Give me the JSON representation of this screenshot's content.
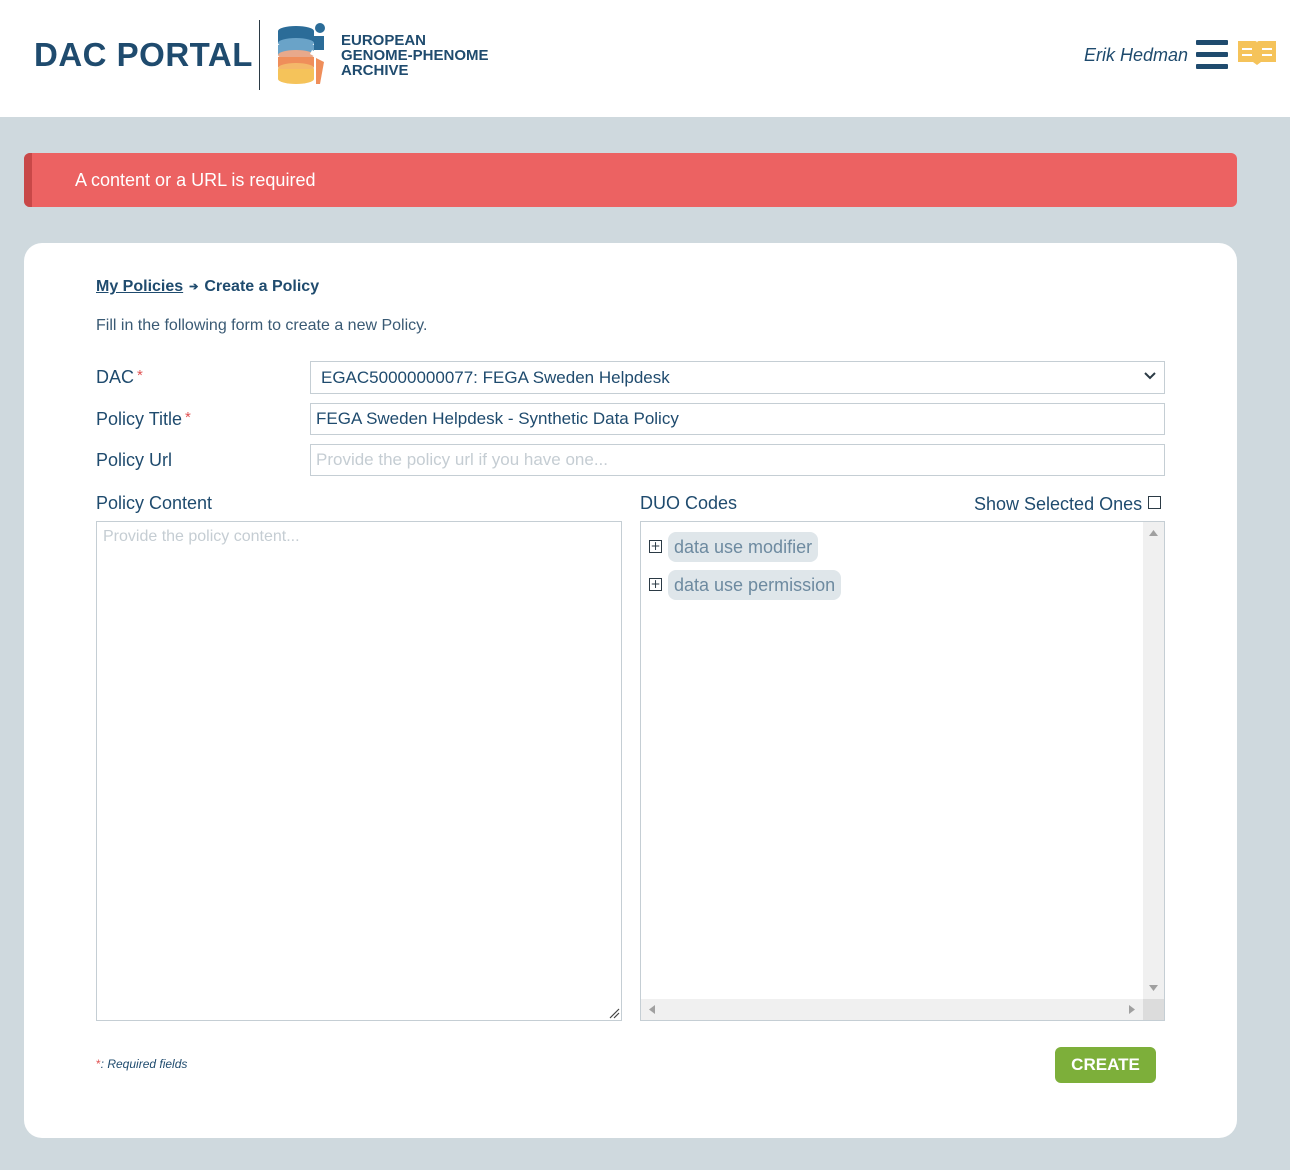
{
  "header": {
    "portal_title": "DAC PORTAL",
    "ega_logo_lines": [
      "EUROPEAN",
      "GENOME-PHENOME",
      "ARCHIVE"
    ],
    "user_name": "Erik Hedman",
    "menu_icon": "hamburger-menu-icon",
    "docs_icon": "open-book-icon",
    "colors": {
      "brand": "#1f4b6e",
      "docs_icon": "#f5c35a"
    }
  },
  "alert": {
    "message": "A content or a URL is required",
    "color": "#ec6262"
  },
  "breadcrumb": {
    "parent": "My Policies",
    "separator": "➔",
    "current": "Create a Policy"
  },
  "form": {
    "intro": "Fill in the following form to create a new Policy.",
    "required_marker": "*",
    "dac": {
      "label": "DAC",
      "value": "EGAC50000000077: FEGA Sweden Helpdesk"
    },
    "policy_title": {
      "label": "Policy Title",
      "value": "FEGA Sweden Helpdesk - Synthetic Data Policy"
    },
    "policy_url": {
      "label": "Policy Url",
      "placeholder": "Provide the policy url if you have one..."
    },
    "policy_content": {
      "label": "Policy Content",
      "placeholder": "Provide the policy content..."
    },
    "duo_codes": {
      "label": "DUO Codes",
      "show_selected_label": "Show Selected Ones",
      "show_selected_checked": false,
      "items": [
        {
          "toggle": "+",
          "label": "data use modifier"
        },
        {
          "toggle": "+",
          "label": "data use permission"
        }
      ]
    },
    "required_note": ": Required fields",
    "create_label": "CREATE",
    "create_color": "#7daf3a"
  }
}
